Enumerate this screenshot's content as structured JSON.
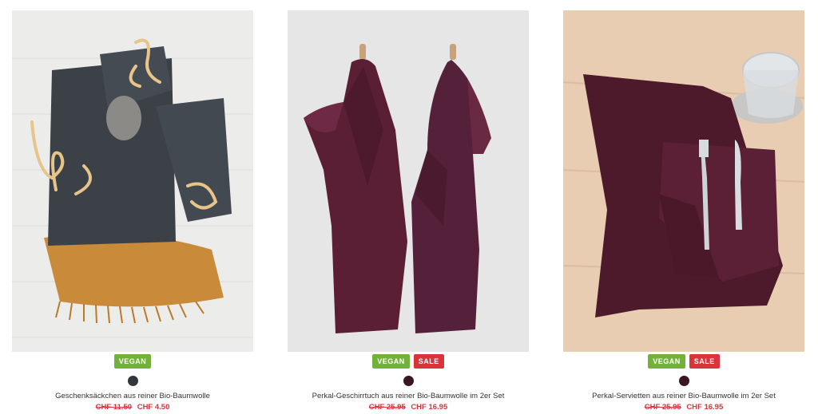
{
  "products": [
    {
      "name": "Geschenksäckchen aus reiner Bio-Baumwolle",
      "badge_vegan": "VEGAN",
      "swatch_color": "#32363d",
      "price_old": "CHF 11.50",
      "price_new": "CHF 4.50",
      "image_icon": "gift-bags-photo"
    },
    {
      "name": "Perkal-Geschirrtuch aus reiner Bio-Baumwolle im 2er Set",
      "badge_vegan": "VEGAN",
      "badge_sale": "SALE",
      "swatch_color": "#3a1524",
      "price_old": "CHF 25.95",
      "price_new": "CHF 16.95",
      "image_icon": "tea-towels-photo"
    },
    {
      "name": "Perkal-Servietten aus reiner Bio-Baumwolle im 2er Set",
      "badge_vegan": "VEGAN",
      "badge_sale": "SALE",
      "swatch_color": "#3a1524",
      "price_old": "CHF 25.95",
      "price_new": "CHF 16.95",
      "image_icon": "napkins-photo"
    }
  ],
  "colors": {
    "vegan": "#73b23a",
    "sale": "#d9343c",
    "price": "#d9343c"
  }
}
